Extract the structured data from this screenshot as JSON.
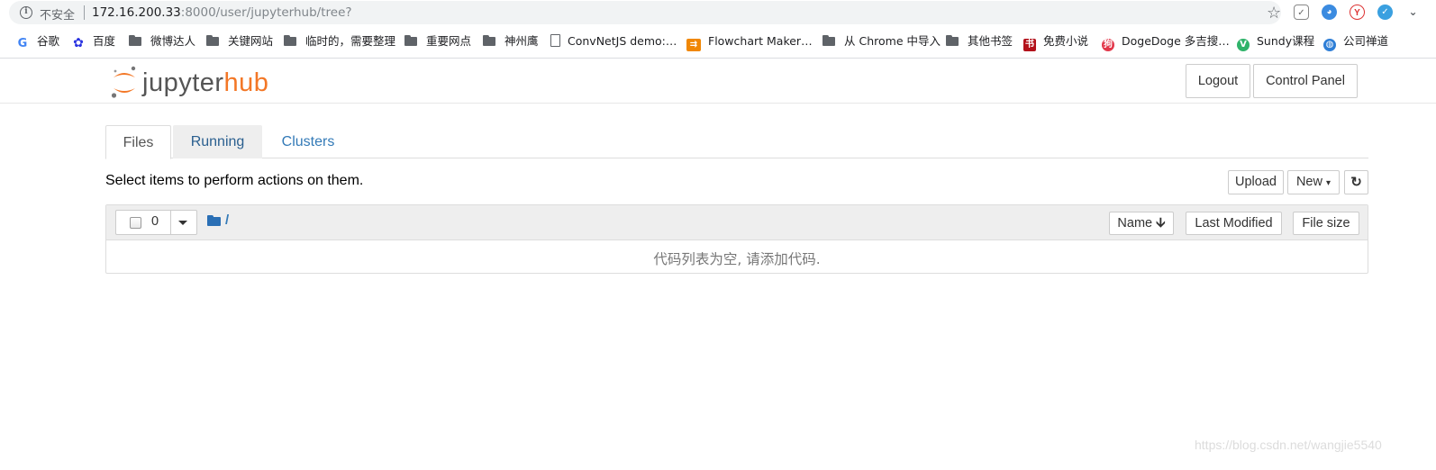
{
  "browser": {
    "security_text": "不安全",
    "url_host": "172.16.200.33",
    "url_path": ":8000/user/jupyterhub/tree?",
    "bookmarks": [
      {
        "label": "谷歌",
        "icon": "google-icon"
      },
      {
        "label": "百度",
        "icon": "baidu-paw-icon"
      },
      {
        "label": "微博达人",
        "icon": "folder-icon"
      },
      {
        "label": "关键网站",
        "icon": "folder-icon"
      },
      {
        "label": "临时的，需要整理",
        "icon": "folder-icon"
      },
      {
        "label": "重要网点",
        "icon": "folder-icon"
      },
      {
        "label": "神州鹰",
        "icon": "folder-icon"
      },
      {
        "label": "ConvNetJS demo:…",
        "icon": "page-icon"
      },
      {
        "label": "Flowchart Maker…",
        "icon": "flowchart-icon"
      },
      {
        "label": "从 Chrome 中导入",
        "icon": "folder-icon"
      },
      {
        "label": "其他书签",
        "icon": "folder-icon"
      },
      {
        "label": "免费小说",
        "icon": "book-icon"
      },
      {
        "label": "DogeDoge 多吉搜…",
        "icon": "dogedoge-icon"
      },
      {
        "label": "Sundy课程",
        "icon": "vue-icon"
      },
      {
        "label": "公司禅道",
        "icon": "globe-icon"
      }
    ]
  },
  "header": {
    "logo_jupyter": "jupyter",
    "logo_hub": "hub",
    "logout_label": "Logout",
    "control_panel_label": "Control Panel"
  },
  "tabs": [
    {
      "label": "Files"
    },
    {
      "label": "Running"
    },
    {
      "label": "Clusters"
    }
  ],
  "toolbar": {
    "message": "Select items to perform actions on them.",
    "upload_label": "Upload",
    "new_label": "New"
  },
  "file_list": {
    "selected_count": "0",
    "breadcrumb_root": "/",
    "columns": {
      "name": "Name",
      "last_modified": "Last Modified",
      "file_size": "File size"
    },
    "empty_message": "代码列表为空, 请添加代码."
  },
  "watermark": "https://blog.csdn.net/wangjie5540",
  "colors": {
    "brand_orange": "#f37726",
    "link_blue": "#337ab7"
  }
}
